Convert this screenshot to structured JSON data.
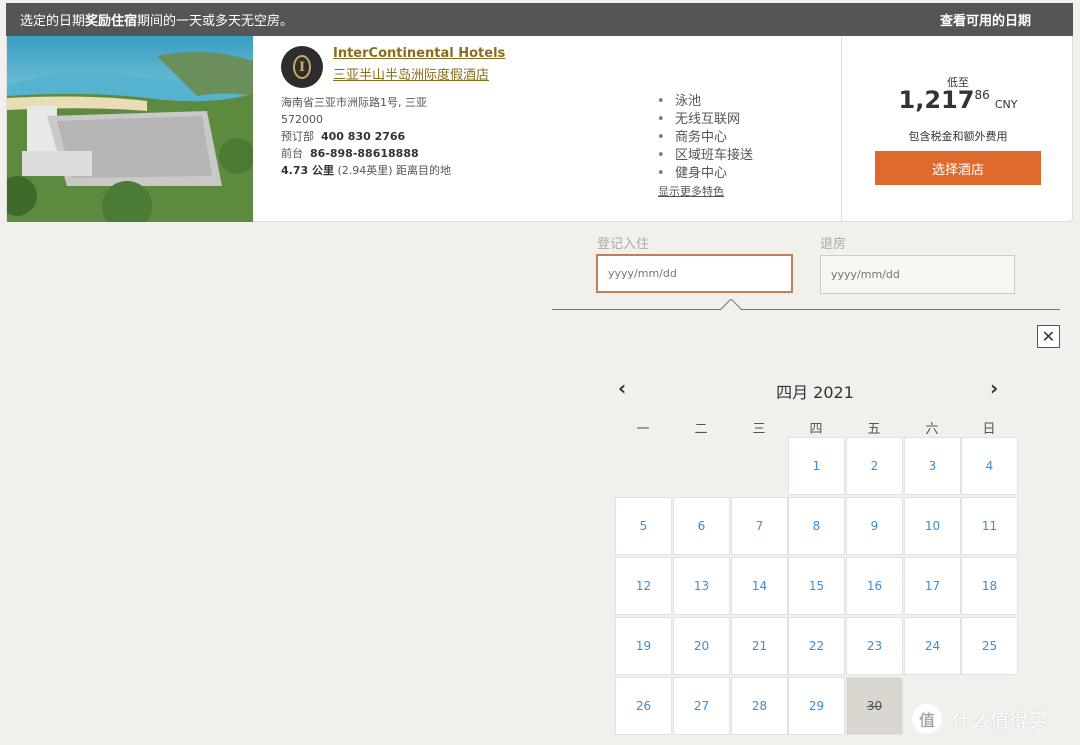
{
  "banner": {
    "prefix": "选定的日期",
    "bold": "奖励住宿",
    "suffix": "期间的一天或多天无空房。",
    "right_link": "查看可用的日期"
  },
  "hotel": {
    "brand": "InterContinental Hotels",
    "name": "三亚半山半岛洲际度假酒店",
    "address_line1": "海南省三亚市洲际路1号, 三亚",
    "postcode": "572000",
    "booking_label": "预订部",
    "booking_phone": "400 830 2766",
    "front_label": "前台",
    "front_phone": "86-898-88618888",
    "distance_strong": "4.73 公里",
    "distance_rest": " (2.94英里) 距离目的地",
    "features": [
      "泳池",
      "无线互联网",
      "商务中心",
      "区域班车接送",
      "健身中心"
    ],
    "more_features": "显示更多特色"
  },
  "price": {
    "from_label": "低至",
    "integer": "1,217",
    "decimal": "86",
    "currency": "CNY",
    "tax_note": "包含税金和额外费用",
    "select_button": "选择酒店"
  },
  "dates": {
    "checkin_label": "登记入住",
    "checkin_placeholder": "yyyy/mm/dd",
    "checkout_label": "退房",
    "checkout_placeholder": "yyyy/mm/dd"
  },
  "calendar": {
    "close_glyph": "✕",
    "prev_glyph": "‹",
    "next_glyph": "›",
    "month_title": "四月  2021",
    "weekdays": [
      "一",
      "二",
      "三",
      "四",
      "五",
      "六",
      "日"
    ],
    "days": [
      "1",
      "2",
      "3",
      "4",
      "5",
      "6",
      "7",
      "8",
      "9",
      "10",
      "11",
      "12",
      "13",
      "14",
      "15",
      "16",
      "17",
      "18",
      "19",
      "20",
      "21",
      "22",
      "23",
      "24",
      "25",
      "26",
      "27",
      "28",
      "29",
      "30"
    ],
    "disabled_day": "30"
  },
  "watermark": {
    "icon_text": "值",
    "text": "什么值得买"
  },
  "colors": {
    "accent": "#df6a2e",
    "link_gold": "#8a6d1f",
    "day_blue": "#3a8fd4",
    "banner_bg": "#555555"
  }
}
